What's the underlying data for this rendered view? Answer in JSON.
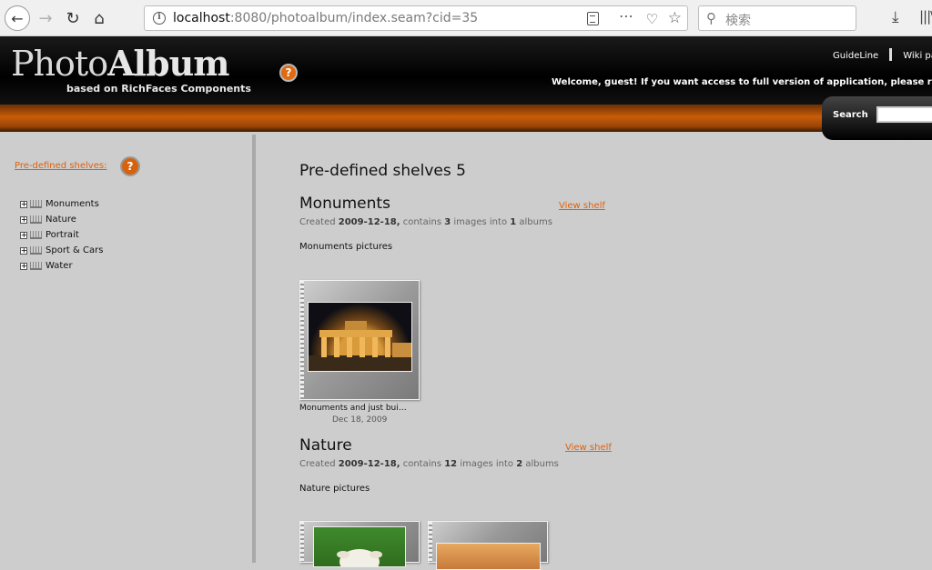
{
  "browser": {
    "url_host": "localhost",
    "url_rest": ":8080/photoalbum/index.seam?cid=35",
    "search_placeholder": "検索"
  },
  "header": {
    "logo_light": "Photo",
    "logo_bold": "Album",
    "logo_sub": "based on RichFaces Components",
    "link_guideline": "GuideLine",
    "link_wiki": "Wiki pa",
    "welcome": "Welcome, guest! If you want access to full version of application, please register",
    "search_label": "Search",
    "help": "?"
  },
  "sidebar": {
    "predefined_label": "Pre-defined shelves:",
    "help": "?",
    "items": [
      {
        "label": "Monuments"
      },
      {
        "label": "Nature"
      },
      {
        "label": "Portrait"
      },
      {
        "label": "Sport & Cars"
      },
      {
        "label": "Water"
      }
    ]
  },
  "main": {
    "title": "Pre-defined shelves 5",
    "shelves": [
      {
        "name": "Monuments",
        "view_link": "View shelf",
        "meta_prefix": "Created ",
        "date": "2009-12-18,",
        "meta_mid1": " contains ",
        "images": "3",
        "meta_mid2": " images into ",
        "albums": "1",
        "meta_suffix": " albums",
        "description": "Monuments pictures",
        "albums_list": [
          {
            "caption": "Monuments and just bui…",
            "date": "Dec 18, 2009"
          }
        ]
      },
      {
        "name": "Nature",
        "view_link": "View shelf",
        "meta_prefix": "Created ",
        "date": "2009-12-18,",
        "meta_mid1": " contains ",
        "images": "12",
        "meta_mid2": " images into ",
        "albums": "2",
        "meta_suffix": " albums",
        "description": "Nature pictures"
      }
    ]
  }
}
